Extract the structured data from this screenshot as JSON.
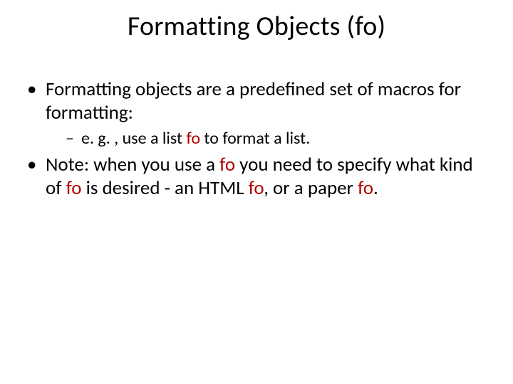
{
  "title": "Formatting Objects (fo)",
  "bullets": {
    "b1": "Formatting objects are a predefined set of macros for formatting:",
    "b1_sub": {
      "pre": "e. g. , use a list ",
      "fo": "fo",
      "post": " to format a list."
    },
    "b2": {
      "t1": "Note:  when you use a ",
      "fo1": "fo",
      "t2": " you need to specify what kind of ",
      "fo2": "fo",
      "t3": " is desired - an HTML ",
      "fo3": "fo",
      "t4": ", or a paper ",
      "fo4": "fo",
      "t5": "."
    }
  }
}
